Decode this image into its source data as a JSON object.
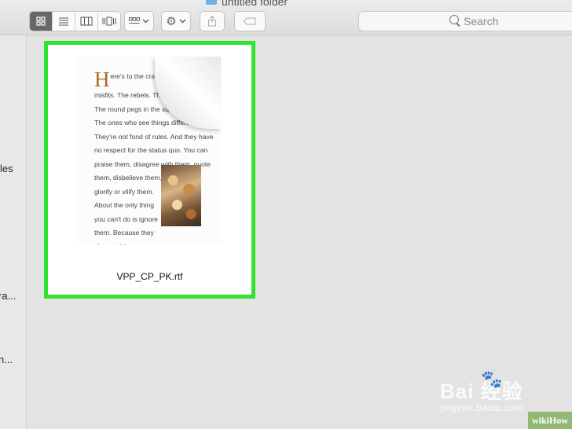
{
  "window": {
    "title": "untitled folder"
  },
  "toolbar": {
    "view_modes": [
      "icon-view",
      "list-view",
      "column-view",
      "cover-flow-view"
    ],
    "search_placeholder": "Search"
  },
  "sidebar": {
    "items": [
      {
        "label": "les"
      },
      {
        "label": "ra..."
      },
      {
        "label": "n..."
      }
    ]
  },
  "file": {
    "name": "VPP_CP_PK.rtf",
    "preview": {
      "dropcap": "H",
      "lines": [
        "ere's to the crazy ones",
        "misfits. The rebels. The trou",
        "The round pegs in the square holes.",
        "The ones who see things differently.",
        "They're not fond of rules. And they have",
        "no respect for the status quo. You can",
        "praise them, disagree with them, quote",
        "them, disbelieve them,",
        "glorify or vilify them.",
        "About the only thing",
        "you can't do is ignore",
        "them. Because they",
        "change things."
      ]
    }
  },
  "colors": {
    "selection": "#2ee431",
    "accent": "#a56a26"
  },
  "watermark": {
    "baidu": "Bai  经验",
    "url": "jingyan.baidu.com",
    "wikihow": "wikiHow"
  }
}
